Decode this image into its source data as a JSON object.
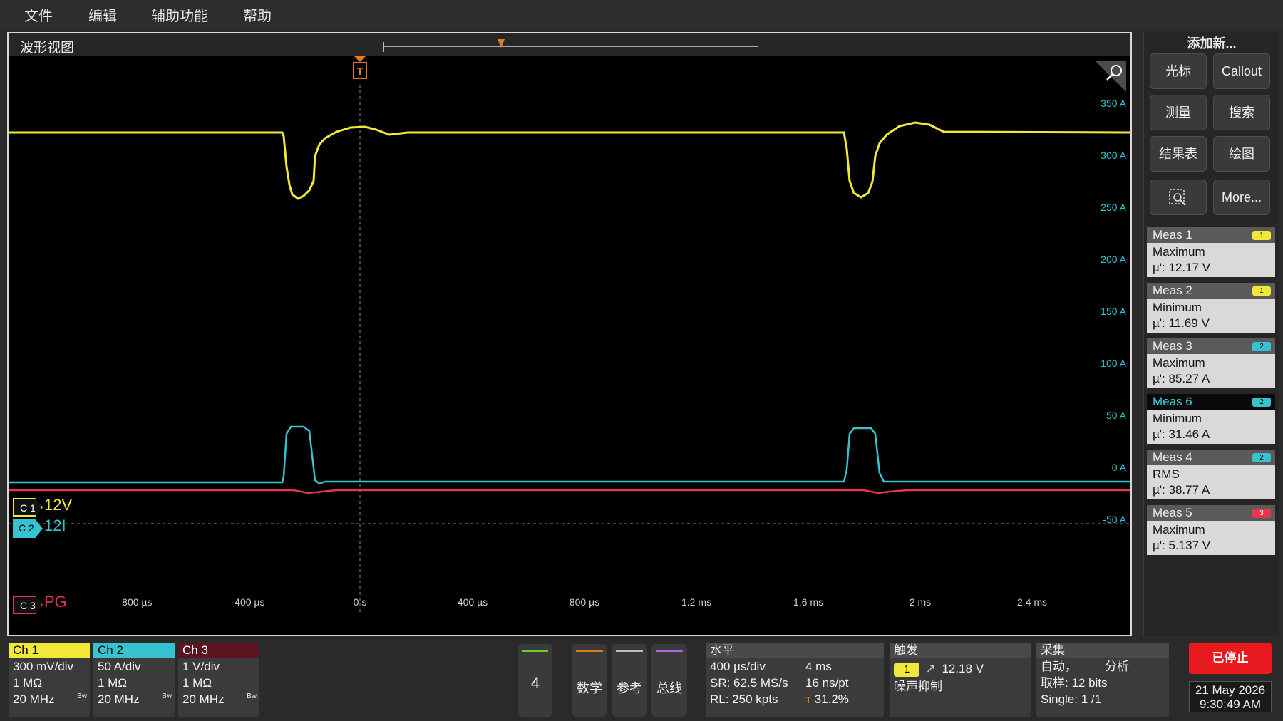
{
  "menu": [
    "文件",
    "编辑",
    "辅助功能",
    "帮助"
  ],
  "waveform_view": {
    "title": "波形视图",
    "trigger_marker": "T",
    "y_axis_labels": [
      "350 A",
      "300 A",
      "250 A",
      "200 A",
      "150 A",
      "100 A",
      "50 A",
      "0 A",
      "-50 A"
    ],
    "x_axis_labels": [
      "-800 µs",
      "-400 µs",
      "0 s",
      "400 µs",
      "800 µs",
      "1.2 ms",
      "1.6 ms",
      "2 ms",
      "2.4 ms"
    ],
    "channel_tags": [
      {
        "tag": "C 1",
        "name": "12V",
        "color": "#f2e83a"
      },
      {
        "tag": "C 2",
        "name": "12I",
        "color": "#36c3cf"
      },
      {
        "tag": "C 3",
        "name": "PG",
        "color": "#e8344c"
      }
    ]
  },
  "side_panel": {
    "title": "添加新...",
    "buttons": [
      "光标",
      "Callout",
      "测量",
      "搜索",
      "结果表",
      "绘图",
      "More..."
    ],
    "zoom_icon": "zoom-select-icon",
    "measurements": [
      {
        "label": "Meas 1",
        "badge": "1",
        "badge_color": "#f2e83a",
        "type": "Maximum",
        "value": "µ': 12.17 V",
        "selected": false
      },
      {
        "label": "Meas 2",
        "badge": "1",
        "badge_color": "#f2e83a",
        "type": "Minimum",
        "value": "µ': 11.69 V",
        "selected": false
      },
      {
        "label": "Meas 3",
        "badge": "2",
        "badge_color": "#36c3cf",
        "type": "Maximum",
        "value": "µ': 85.27 A",
        "selected": false
      },
      {
        "label": "Meas 6",
        "badge": "2",
        "badge_color": "#36c3cf",
        "type": "Minimum",
        "value": "µ': 31.46 A",
        "selected": true
      },
      {
        "label": "Meas 4",
        "badge": "2",
        "badge_color": "#36c3cf",
        "type": "RMS",
        "value": "µ': 38.77 A",
        "selected": false
      },
      {
        "label": "Meas 5",
        "badge": "3",
        "badge_color": "#e8344c",
        "type": "Maximum",
        "value": "µ': 5.137 V",
        "selected": false
      }
    ]
  },
  "channels": [
    {
      "name": "Ch 1",
      "scale": "300 mV/div",
      "impedance": "1 MΩ",
      "bandwidth": "20 MHz",
      "bw_mark": "Bw",
      "color": "#f2e83a"
    },
    {
      "name": "Ch 2",
      "scale": "50 A/div",
      "impedance": "1 MΩ",
      "bandwidth": "20 MHz",
      "bw_mark": "Bw",
      "color": "#36c3cf"
    },
    {
      "name": "Ch 3",
      "scale": "1 V/div",
      "impedance": "1 MΩ",
      "bandwidth": "20 MHz",
      "bw_mark": "Bw",
      "color": "#e8344c"
    }
  ],
  "bottom_buttons": {
    "ch4": "4",
    "math": "数学",
    "ref": "参考",
    "bus": "总线"
  },
  "horizontal": {
    "title": "水平",
    "scale": "400 µs/div",
    "duration": "4 ms",
    "sample_rate": "SR: 62.5 MS/s",
    "resolution": "16 ns/pt",
    "record_length": "RL: 250 kpts",
    "position": "31.2%"
  },
  "trigger": {
    "title": "触发",
    "source": "1",
    "level": "12.18 V",
    "noise_reject": "噪声抑制"
  },
  "acquisition": {
    "title": "采集",
    "mode": "自动，",
    "analysis": "分析",
    "sampling": "取样: 12 bits",
    "single": "Single: 1 /1"
  },
  "status": {
    "stopped": "已停止",
    "date": "21 May 2026",
    "time": "9:30:49 AM"
  }
}
